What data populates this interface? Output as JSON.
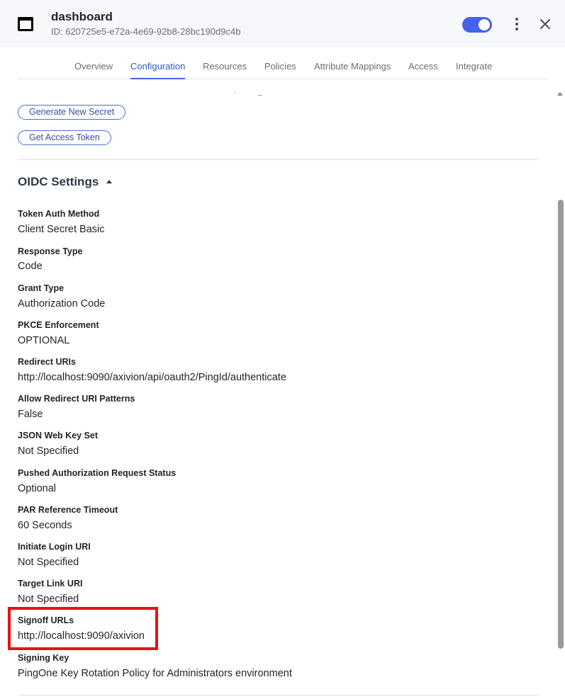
{
  "header": {
    "title": "dashboard",
    "id_text": "ID: 620725e5-e72a-4e69-92b8-28bc190d9c4b",
    "enabled": true,
    "icons": {
      "app": "application-icon",
      "more": "kebab-menu-icon",
      "close": "close-icon"
    }
  },
  "tabs": [
    {
      "label": "Overview",
      "active": false
    },
    {
      "label": "Configuration",
      "active": true
    },
    {
      "label": "Resources",
      "active": false
    },
    {
      "label": "Policies",
      "active": false
    },
    {
      "label": "Attribute Mappings",
      "active": false
    },
    {
      "label": "Access",
      "active": false
    },
    {
      "label": "Integrate",
      "active": false
    }
  ],
  "buttons": {
    "generate_secret": "Generate New Secret",
    "get_token": "Get Access Token"
  },
  "oidc": {
    "title": "OIDC Settings",
    "fields": [
      {
        "label": "Token Auth Method",
        "value": "Client Secret Basic"
      },
      {
        "label": "Response Type",
        "value": "Code"
      },
      {
        "label": "Grant Type",
        "value": "Authorization Code"
      },
      {
        "label": "PKCE Enforcement",
        "value": "OPTIONAL"
      },
      {
        "label": "Redirect URIs",
        "value": "http://localhost:9090/axivion/api/oauth2/PingId/authenticate"
      },
      {
        "label": "Allow Redirect URI Patterns",
        "value": "False"
      },
      {
        "label": "JSON Web Key Set",
        "value": "Not Specified"
      },
      {
        "label": "Pushed Authorization Request Status",
        "value": "Optional"
      },
      {
        "label": "PAR Reference Timeout",
        "value": "60 Seconds"
      },
      {
        "label": "Initiate Login URI",
        "value": "Not Specified"
      },
      {
        "label": "Target Link URI",
        "value": "Not Specified"
      },
      {
        "label": "Signoff URLs",
        "value": "http://localhost:9090/axivion"
      },
      {
        "label": "Signing Key",
        "value": "PingOne Key Rotation Policy for Administrators environment"
      }
    ]
  },
  "colors": {
    "accent": "#4462ed",
    "highlight": "#e8101a",
    "header_bg": "#f7f8fc"
  }
}
